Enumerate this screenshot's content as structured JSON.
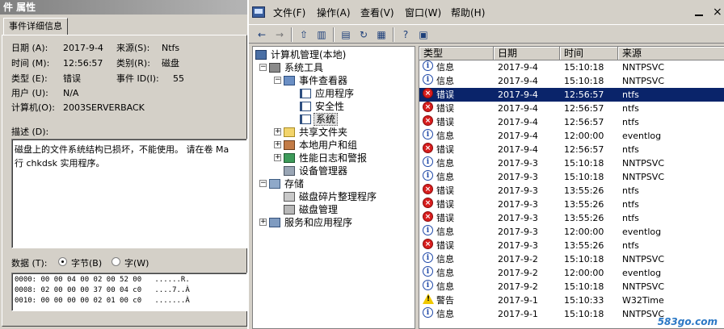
{
  "props": {
    "title": "件 属性",
    "tab_label": "事件详细信息",
    "date_label": "日期 (A):",
    "date_value": "2017-9-4",
    "source_label": "来源(S):",
    "source_value": "Ntfs",
    "time_label": "时间 (M):",
    "time_value": "12:56:57",
    "category_label": "类别(R):",
    "category_value": "磁盘",
    "type_label": "类型 (E):",
    "type_value": "错误",
    "eventid_label": "事件 ID(I):",
    "eventid_value": "55",
    "user_label": "用户 (U):",
    "user_value": "N/A",
    "computer_label": "计算机(O):",
    "computer_value": "2003SERVERBACK",
    "desc_label": "描述 (D):",
    "desc_text": "磁盘上的文件系统结构已损坏，不能使用。 请在卷 Ma\n行 chkdsk 实用程序。",
    "data_label": "数据 (T):",
    "bytes_label": "字节(B)",
    "words_label": "字(W)",
    "data_mode": "bytes",
    "hex_lines": [
      "0000: 00 00 04 00 02 00 52 00   ......R.",
      "0008: 02 00 00 00 37 00 04 c0   ....7..À",
      "0010: 00 00 00 00 02 01 00 c0   .......À"
    ]
  },
  "mmc": {
    "menus": [
      "文件(F)",
      "操作(A)",
      "查看(V)",
      "窗口(W)",
      "帮助(H)"
    ],
    "close_glyph": "×",
    "tree": [
      {
        "label": "计算机管理(本地)",
        "icon": "computer-icon"
      },
      {
        "label": "系统工具",
        "icon": "tools-icon"
      },
      {
        "label": "事件查看器",
        "icon": "event-viewer-icon"
      },
      {
        "label": "应用程序",
        "icon": "log-icon"
      },
      {
        "label": "安全性",
        "icon": "log-icon"
      },
      {
        "label": "系统",
        "icon": "log-icon"
      },
      {
        "label": "共享文件夹",
        "icon": "folder-icon"
      },
      {
        "label": "本地用户和组",
        "icon": "users-icon"
      },
      {
        "label": "性能日志和警报",
        "icon": "performance-icon"
      },
      {
        "label": "设备管理器",
        "icon": "device-icon"
      },
      {
        "label": "存储",
        "icon": "storage-icon"
      },
      {
        "label": "磁盘碎片整理程序",
        "icon": "defrag-icon"
      },
      {
        "label": "磁盘管理",
        "icon": "disk-icon"
      },
      {
        "label": "服务和应用程序",
        "icon": "services-icon"
      }
    ],
    "columns": [
      "类型",
      "日期",
      "时间",
      "来源"
    ],
    "events": [
      {
        "type": "信息",
        "sev": "info",
        "date": "2017-9-4",
        "time": "15:10:18",
        "source": "NNTPSVC"
      },
      {
        "type": "信息",
        "sev": "info",
        "date": "2017-9-4",
        "time": "15:10:18",
        "source": "NNTPSVC"
      },
      {
        "type": "错误",
        "sev": "error",
        "date": "2017-9-4",
        "time": "12:56:57",
        "source": "ntfs"
      },
      {
        "type": "错误",
        "sev": "error",
        "date": "2017-9-4",
        "time": "12:56:57",
        "source": "ntfs"
      },
      {
        "type": "错误",
        "sev": "error",
        "date": "2017-9-4",
        "time": "12:56:57",
        "source": "ntfs"
      },
      {
        "type": "信息",
        "sev": "info",
        "date": "2017-9-4",
        "time": "12:00:00",
        "source": "eventlog"
      },
      {
        "type": "错误",
        "sev": "error",
        "date": "2017-9-4",
        "time": "12:56:57",
        "source": "ntfs"
      },
      {
        "type": "信息",
        "sev": "info",
        "date": "2017-9-3",
        "time": "15:10:18",
        "source": "NNTPSVC"
      },
      {
        "type": "信息",
        "sev": "info",
        "date": "2017-9-3",
        "time": "15:10:18",
        "source": "NNTPSVC"
      },
      {
        "type": "错误",
        "sev": "error",
        "date": "2017-9-3",
        "time": "13:55:26",
        "source": "ntfs"
      },
      {
        "type": "错误",
        "sev": "error",
        "date": "2017-9-3",
        "time": "13:55:26",
        "source": "ntfs"
      },
      {
        "type": "错误",
        "sev": "error",
        "date": "2017-9-3",
        "time": "13:55:26",
        "source": "ntfs"
      },
      {
        "type": "信息",
        "sev": "info",
        "date": "2017-9-3",
        "time": "12:00:00",
        "source": "eventlog"
      },
      {
        "type": "错误",
        "sev": "error",
        "date": "2017-9-3",
        "time": "13:55:26",
        "source": "ntfs"
      },
      {
        "type": "信息",
        "sev": "info",
        "date": "2017-9-2",
        "time": "15:10:18",
        "source": "NNTPSVC"
      },
      {
        "type": "信息",
        "sev": "info",
        "date": "2017-9-2",
        "time": "12:00:00",
        "source": "eventlog"
      },
      {
        "type": "信息",
        "sev": "info",
        "date": "2017-9-2",
        "time": "15:10:18",
        "source": "NNTPSVC"
      },
      {
        "type": "警告",
        "sev": "warn",
        "date": "2017-9-1",
        "time": "15:10:33",
        "source": "W32Time"
      },
      {
        "type": "信息",
        "sev": "info",
        "date": "2017-9-1",
        "time": "15:10:18",
        "source": "NNTPSVC"
      }
    ],
    "selected_event": 2,
    "selection_color": "#0a246a"
  },
  "watermark": "583go.com"
}
